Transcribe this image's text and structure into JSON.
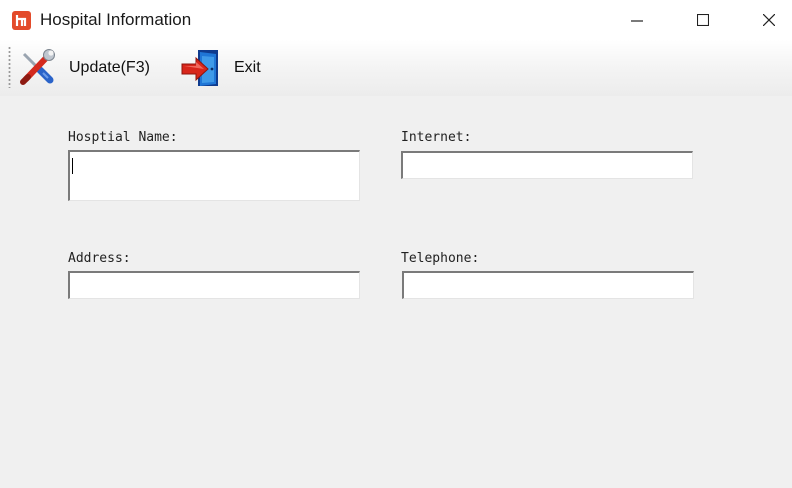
{
  "window": {
    "title": "Hospital Information",
    "controls": [
      "minimize-icon",
      "maximize-icon",
      "close-icon"
    ]
  },
  "toolbar": {
    "update": {
      "label": "Update(F3)",
      "icon": "wrench-screwdriver-icon"
    },
    "exit": {
      "label": "Exit",
      "icon": "exit-door-icon"
    }
  },
  "form": {
    "hospital_name": {
      "label": "Hosptial Name:",
      "value": ""
    },
    "internet": {
      "label": "Internet:",
      "value": ""
    },
    "address": {
      "label": "Address:",
      "value": ""
    },
    "telephone": {
      "label": "Telephone:",
      "value": ""
    }
  },
  "colors": {
    "app_icon": "#e34b2b",
    "window_bg": "#f0f0f0",
    "titlebar_bg": "#ffffff"
  }
}
